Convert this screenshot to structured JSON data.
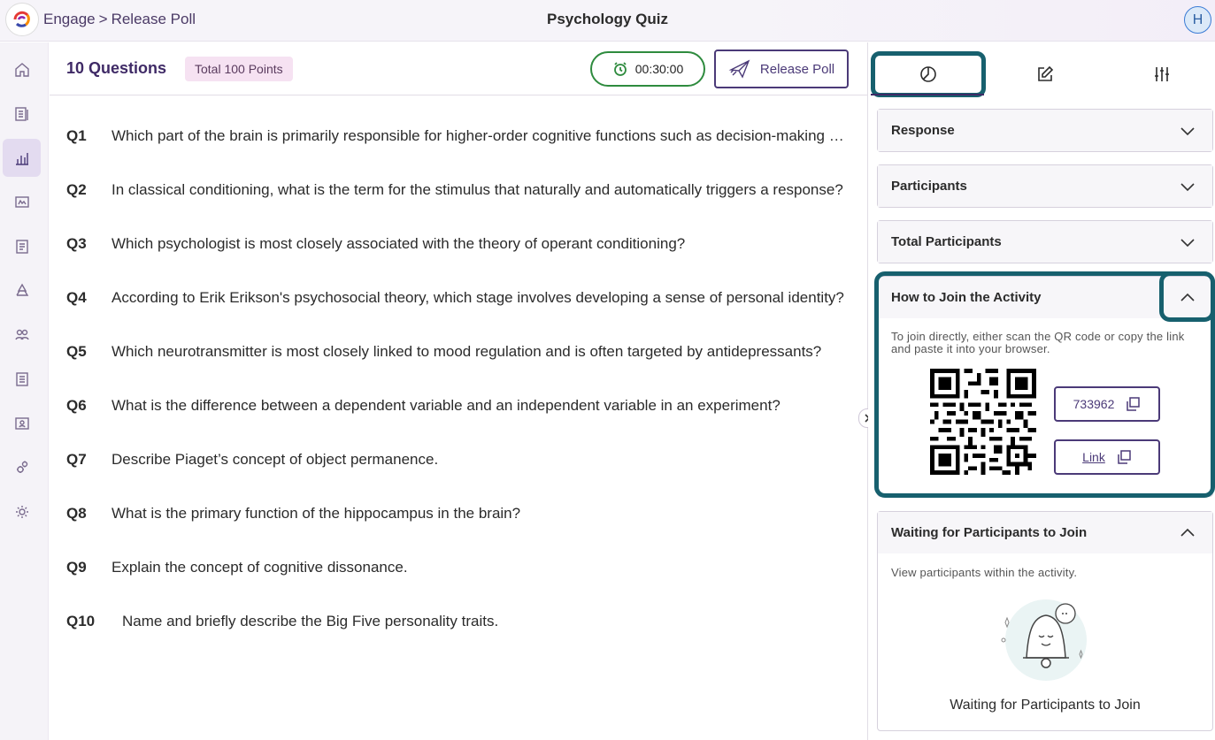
{
  "header": {
    "breadcrumb": [
      "Engage",
      "Release Poll"
    ],
    "breadcrumb_separator": ">",
    "title": "Psychology Quiz",
    "avatar_initial": "H"
  },
  "sidebar": {
    "items": [
      {
        "icon": "home-icon"
      },
      {
        "icon": "library-icon"
      },
      {
        "icon": "analytics-icon",
        "active": true
      },
      {
        "icon": "presentation-icon"
      },
      {
        "icon": "gradebook-icon"
      },
      {
        "icon": "recycle-icon"
      },
      {
        "icon": "groups-icon"
      },
      {
        "icon": "list-icon"
      },
      {
        "icon": "reports-icon"
      },
      {
        "icon": "integrations-icon"
      },
      {
        "icon": "settings-icon"
      }
    ]
  },
  "main": {
    "question_count": "10 Questions",
    "points": "Total 100 Points",
    "timer": "00:30:00",
    "release_label": "Release Poll",
    "questions": [
      {
        "num": "Q1",
        "text": "Which part of the brain is primarily responsible for higher-order cognitive functions such as decision-making and planning?"
      },
      {
        "num": "Q2",
        "text": "In classical conditioning, what is the term for the stimulus that naturally and automatically triggers a response?"
      },
      {
        "num": "Q3",
        "text": "Which psychologist is most closely associated with the theory of operant conditioning?"
      },
      {
        "num": "Q4",
        "text": "According to Erik Erikson's psychosocial theory, which stage involves developing a sense of personal identity?"
      },
      {
        "num": "Q5",
        "text": "Which neurotransmitter is most closely linked to mood regulation and is often targeted by antidepressants?"
      },
      {
        "num": "Q6",
        "text": "What is the difference between a dependent variable and an independent variable in an experiment?"
      },
      {
        "num": "Q7",
        "text": "Describe Piaget’s concept of object permanence."
      },
      {
        "num": "Q8",
        "text": "What is the primary function of the hippocampus in the brain?"
      },
      {
        "num": "Q9",
        "text": "Explain the concept of cognitive dissonance."
      },
      {
        "num": "Q10",
        "text": "Name and briefly describe the Big Five personality traits."
      }
    ]
  },
  "right_panel": {
    "tabs": [
      {
        "icon": "pie-chart-icon",
        "active": true
      },
      {
        "icon": "edit-icon"
      },
      {
        "icon": "sliders-icon"
      }
    ],
    "sections": {
      "response": "Response",
      "participants": "Participants",
      "total_participants": "Total Participants",
      "join": {
        "title": "How to Join the Activity",
        "instructions": "To join directly, either scan the QR code or copy the link and paste it into your browser.",
        "code": "733962",
        "link_label": "Link"
      },
      "waiting": {
        "title": "Waiting for Participants to Join",
        "subtitle": "View participants within the activity.",
        "caption": "Waiting for Participants to Join"
      }
    }
  },
  "colors": {
    "brand_purple": "#4b3a78",
    "highlight_teal": "#17606e",
    "timer_green": "#2e8b3e",
    "points_badge_bg": "#f6e2f2"
  }
}
